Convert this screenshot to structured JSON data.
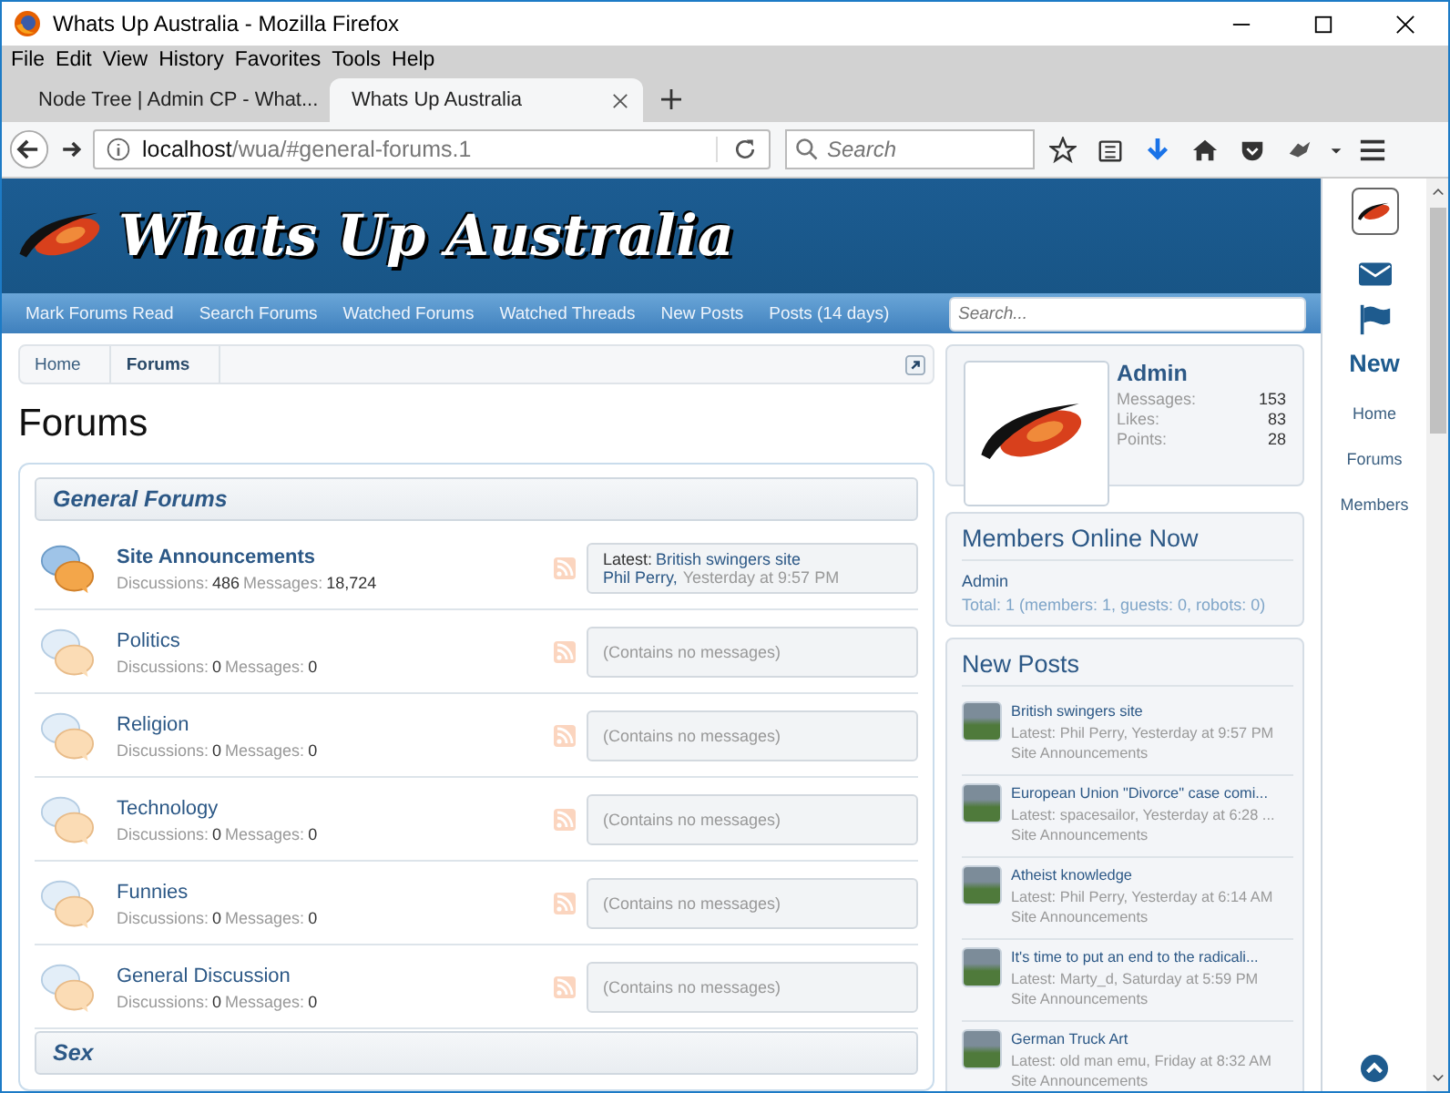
{
  "window": {
    "title": "Whats Up Australia - Mozilla Firefox"
  },
  "menu": [
    "File",
    "Edit",
    "View",
    "History",
    "Favorites",
    "Tools",
    "Help"
  ],
  "tabs": [
    {
      "label": "Node Tree | Admin CP - What...",
      "selected": false
    },
    {
      "label": "Whats Up Australia",
      "selected": true
    }
  ],
  "address": {
    "host": "localhost",
    "path": "/wua/#general-forums.1"
  },
  "browser_search": {
    "placeholder": "Search"
  },
  "site": {
    "logo_text": "Whats Up Australia",
    "nav_links": [
      "Mark Forums Read",
      "Search Forums",
      "Watched Forums",
      "Watched Threads",
      "New Posts",
      "Posts (14 days)"
    ],
    "search": {
      "placeholder": "Search..."
    }
  },
  "breadcrumb": [
    {
      "label": "Home",
      "selected": false
    },
    {
      "label": "Forums",
      "selected": true
    }
  ],
  "page_title": "Forums",
  "categories": [
    {
      "title": "General Forums",
      "forums": [
        {
          "name": "Site Announcements",
          "unread": true,
          "stats": [
            {
              "label": "Discussions:",
              "value": "486"
            },
            {
              "label": "Messages:",
              "value": "18,724"
            }
          ],
          "latest": {
            "label": "Latest:",
            "title": "British swingers site",
            "author": "Phil Perry,",
            "time": "Yesterday at 9:57 PM"
          }
        },
        {
          "name": "Politics",
          "unread": false,
          "stats": [
            {
              "label": "Discussions:",
              "value": "0"
            },
            {
              "label": "Messages:",
              "value": "0"
            }
          ],
          "empty_text": "(Contains no messages)"
        },
        {
          "name": "Religion",
          "unread": false,
          "stats": [
            {
              "label": "Discussions:",
              "value": "0"
            },
            {
              "label": "Messages:",
              "value": "0"
            }
          ],
          "empty_text": "(Contains no messages)"
        },
        {
          "name": "Technology",
          "unread": false,
          "stats": [
            {
              "label": "Discussions:",
              "value": "0"
            },
            {
              "label": "Messages:",
              "value": "0"
            }
          ],
          "empty_text": "(Contains no messages)"
        },
        {
          "name": "Funnies",
          "unread": false,
          "stats": [
            {
              "label": "Discussions:",
              "value": "0"
            },
            {
              "label": "Messages:",
              "value": "0"
            }
          ],
          "empty_text": "(Contains no messages)"
        },
        {
          "name": "General Discussion",
          "unread": false,
          "stats": [
            {
              "label": "Discussions:",
              "value": "0"
            },
            {
              "label": "Messages:",
              "value": "0"
            }
          ],
          "empty_text": "(Contains no messages)"
        }
      ]
    },
    {
      "title": "Sex"
    }
  ],
  "profile": {
    "name": "Admin",
    "stats": [
      {
        "label": "Messages:",
        "value": "153"
      },
      {
        "label": "Likes:",
        "value": "83"
      },
      {
        "label": "Points:",
        "value": "28"
      }
    ]
  },
  "members_online": {
    "title": "Members Online Now",
    "members": [
      "Admin"
    ],
    "total": "Total: 1 (members: 1, guests: 0, robots: 0)"
  },
  "new_posts": {
    "title": "New Posts",
    "items": [
      {
        "title": "British swingers site",
        "latest": "Latest: Phil Perry, Yesterday at 9:57 PM",
        "forum": "Site Announcements"
      },
      {
        "title": "European Union \"Divorce\" case comi...",
        "latest": "Latest: spacesailor, Yesterday at 6:28 ...",
        "forum": "Site Announcements"
      },
      {
        "title": "Atheist knowledge",
        "latest": "Latest: Phil Perry, Yesterday at 6:14 AM",
        "forum": "Site Announcements"
      },
      {
        "title": "It's time to put an end to the radicali...",
        "latest": "Latest: Marty_d, Saturday at 5:59 PM",
        "forum": "Site Announcements"
      },
      {
        "title": "German Truck Art",
        "latest": "Latest: old man emu, Friday at 8:32 AM",
        "forum": "Site Announcements"
      }
    ]
  },
  "rail": {
    "new_label": "New",
    "links": [
      "Home",
      "Forums",
      "Members"
    ]
  }
}
